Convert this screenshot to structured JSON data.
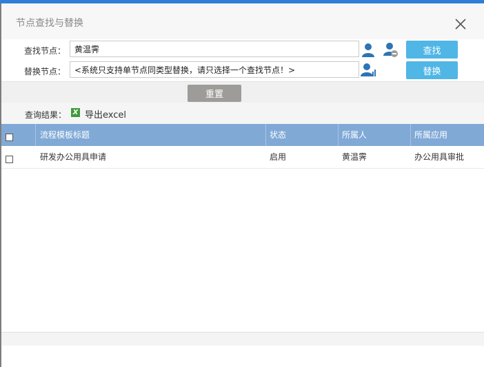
{
  "dialog": {
    "title": "节点查找与替换"
  },
  "search": {
    "find_label": "查找节点：",
    "find_value": "黄温霁",
    "replace_label": "替换节点：",
    "replace_value": "<系统只支持单节点同类型替换，请只选择一个查找节点！>",
    "find_button": "查找",
    "replace_button": "替换",
    "reset_button": "重置"
  },
  "results": {
    "label": "查询结果：",
    "export_label": "导出excel"
  },
  "grid": {
    "columns": [
      "流程模板标题",
      "状态",
      "所属人",
      "所属应用"
    ],
    "rows": [
      [
        "研发办公用具申请",
        "启用",
        "黄温霁",
        "办公用具审批"
      ]
    ]
  },
  "colors": {
    "accent": "#2f7fd8",
    "button": "#4fb6e6",
    "header": "#80a9d6",
    "reset": "#9d9c98"
  }
}
